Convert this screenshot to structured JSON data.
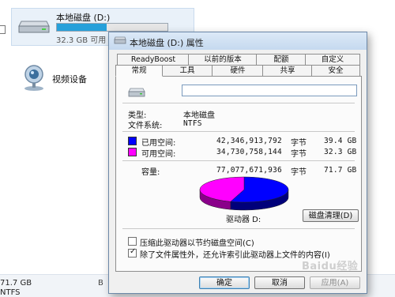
{
  "background": {
    "drive_name": "本地磁盘 (D:)",
    "drive_free": "32.3 GB 可用",
    "drive_used_fraction": 0.45,
    "webcam_label": "视频设备",
    "bottom_size": "71.7 GB",
    "bottom_fs": "NTFS",
    "bottom_b": "B"
  },
  "dialog": {
    "title": "本地磁盘 (D:) 属性",
    "tabs_back": [
      "ReadyBoost",
      "以前的版本",
      "配额",
      "自定义"
    ],
    "tabs_front": [
      "常规",
      "工具",
      "硬件",
      "共享",
      "安全"
    ],
    "active_tab": "常规",
    "name_value": "",
    "type_label": "类型:",
    "type_value": "本地磁盘",
    "fs_label": "文件系统:",
    "fs_value": "NTFS",
    "used_label": "已用空间:",
    "used_bytes": "42,346,913,792",
    "used_size": "39.4 GB",
    "free_label": "可用空间:",
    "free_bytes": "34,730,758,144",
    "free_size": "32.3 GB",
    "capacity_label": "容量:",
    "capacity_bytes": "77,077,671,936",
    "capacity_size": "71.7 GB",
    "bytes_unit": "字节",
    "drive_label": "驱动器 D:",
    "cleanup_button": "磁盘清理(D)",
    "compress_label": "压缩此驱动器以节约磁盘空间(C)",
    "compress_checked": false,
    "index_label": "除了文件属性外，还允许索引此驱动器上文件的内容(I)",
    "index_checked": true,
    "ok_button": "确定",
    "cancel_button": "取消",
    "apply_button": "应用(A)",
    "used_color": "#0000ff",
    "free_color": "#ff00ff"
  },
  "chart_data": {
    "type": "pie",
    "categories": [
      "已用空间",
      "可用空间"
    ],
    "values": [
      39.4,
      32.3
    ]
  },
  "watermark": "Baidu经验"
}
